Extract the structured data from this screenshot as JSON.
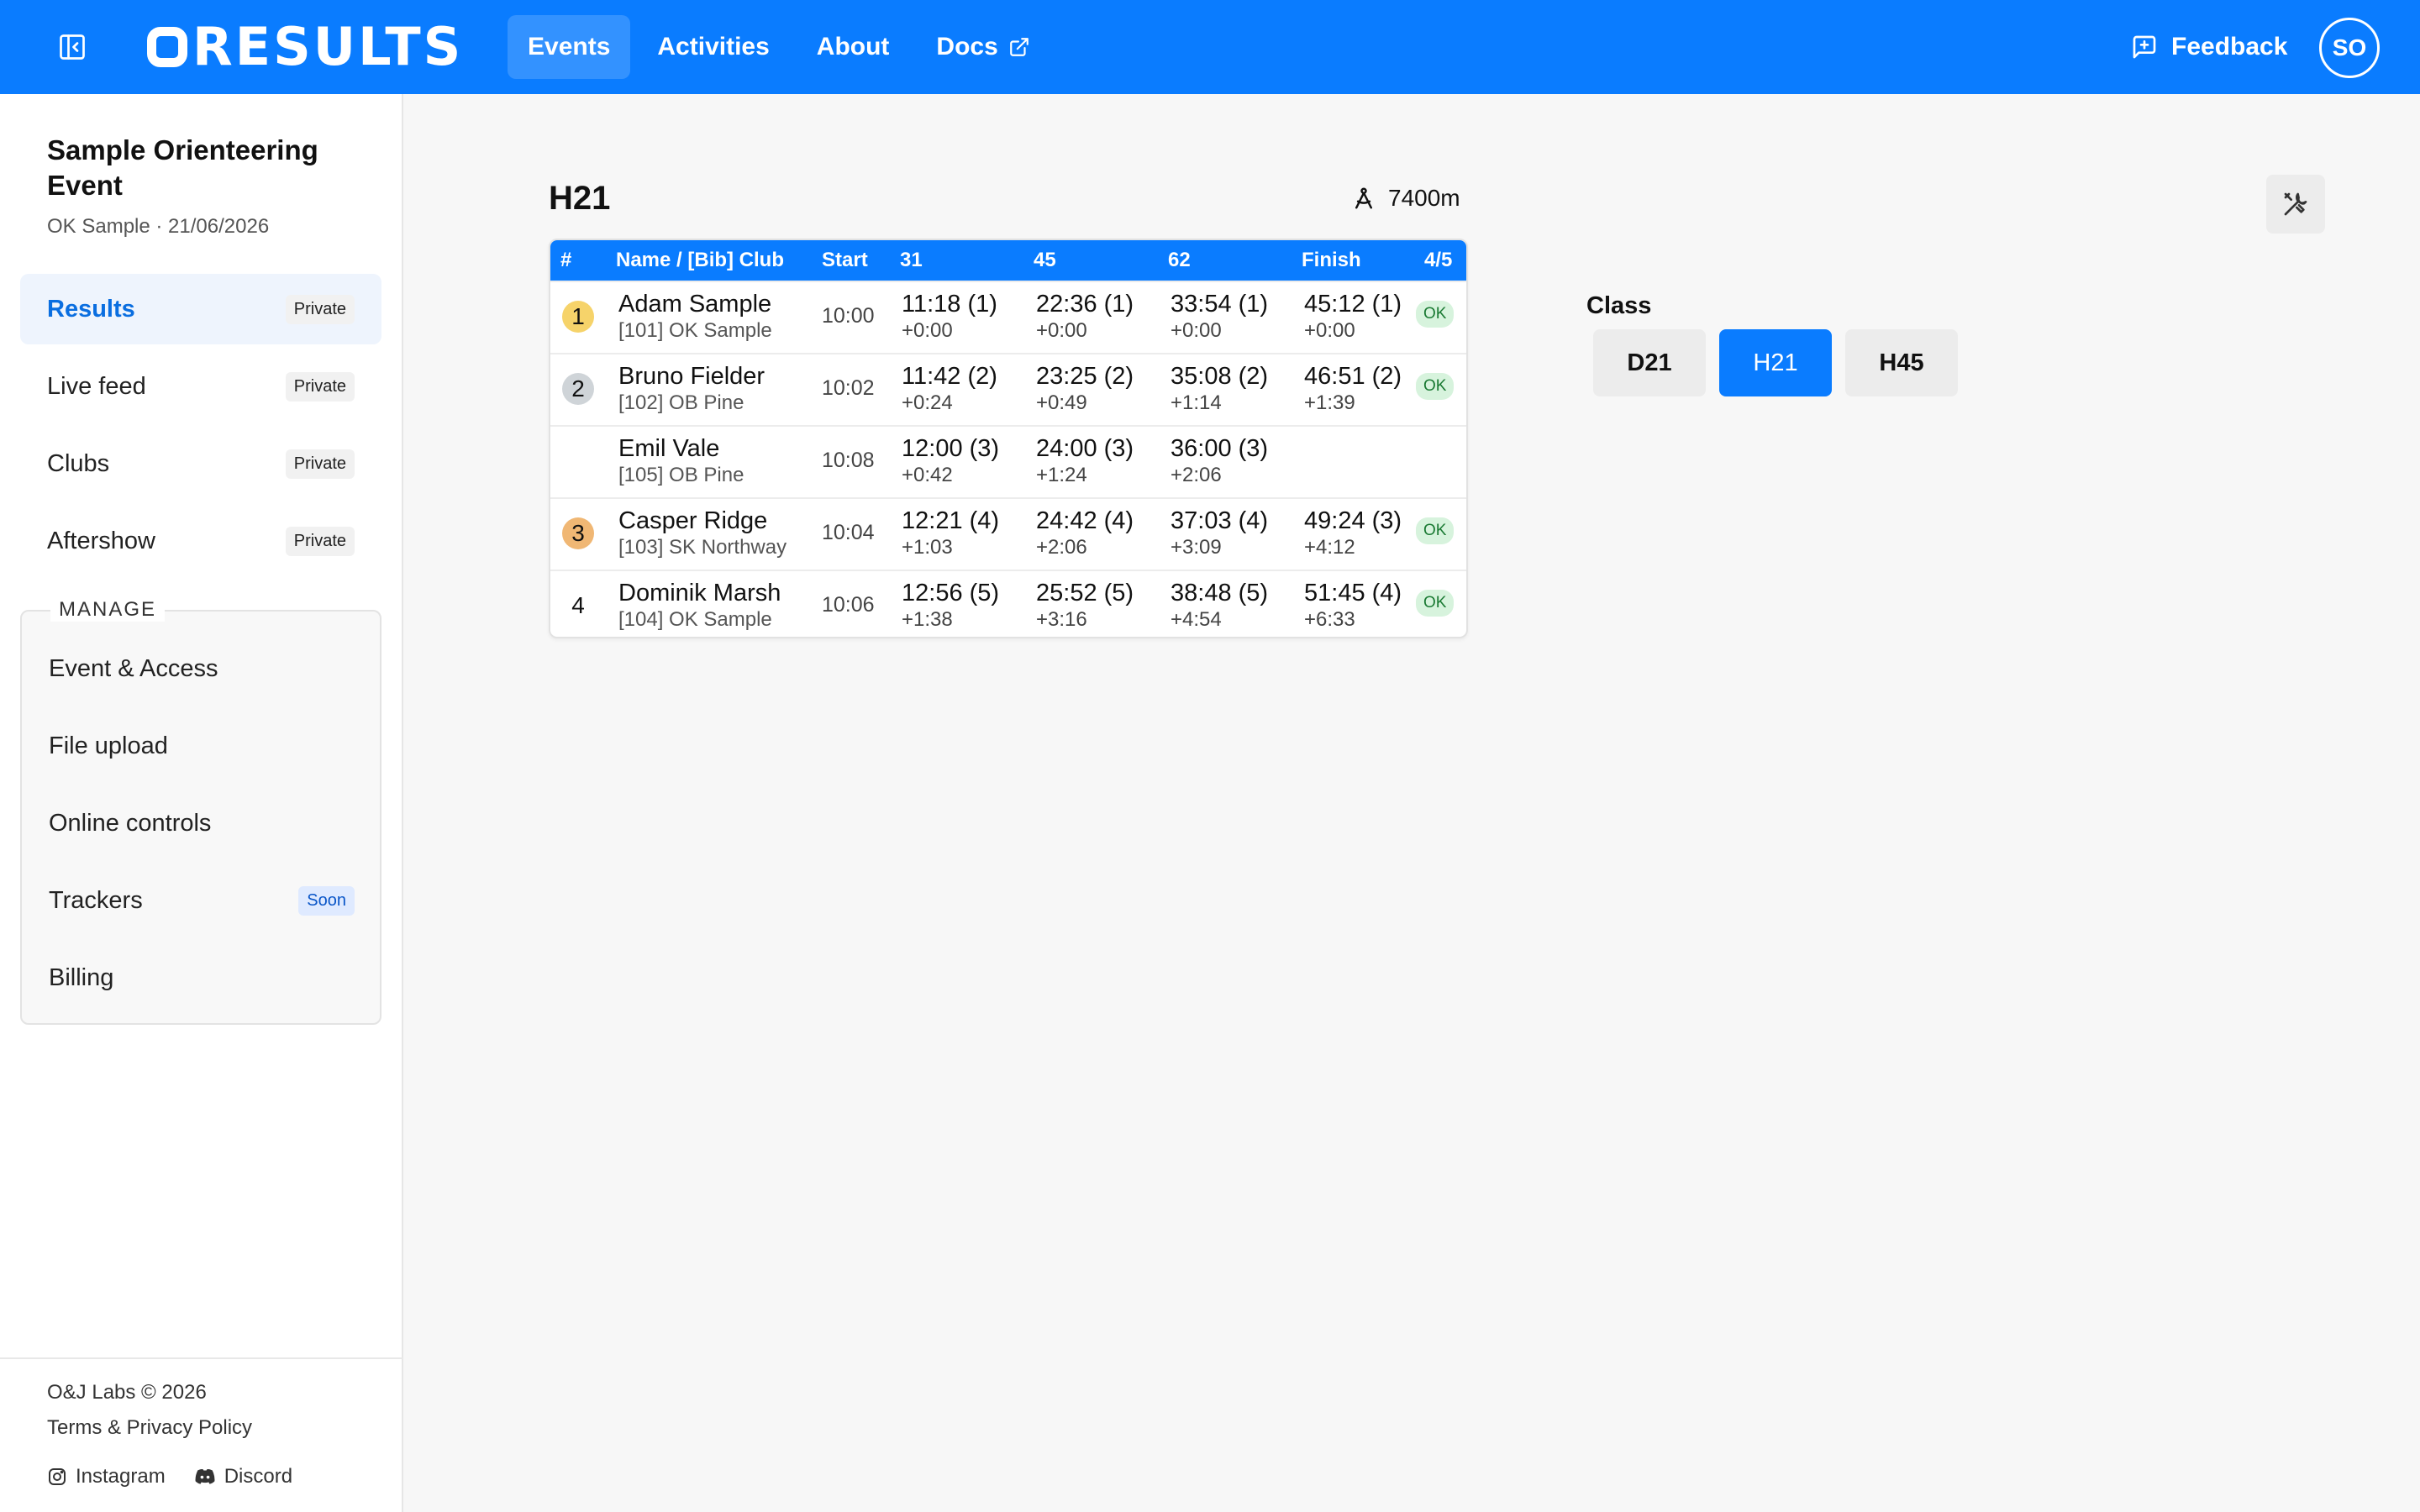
{
  "topbar": {
    "logo_text": "RESULTS",
    "nav": [
      {
        "label": "Events",
        "active": true
      },
      {
        "label": "Activities",
        "active": false
      },
      {
        "label": "About",
        "active": false
      },
      {
        "label": "Docs",
        "active": false,
        "icon": "external-link-icon"
      }
    ],
    "feedback_label": "Feedback",
    "avatar_initials": "SO",
    "accent_color": "#0a7cff"
  },
  "sidebar": {
    "event_title": "Sample Orienteering Event",
    "event_subtitle": "OK Sample · 21/06/2026",
    "items": [
      {
        "label": "Results",
        "badge": "Private",
        "active": true
      },
      {
        "label": "Live feed",
        "badge": "Private"
      },
      {
        "label": "Clubs",
        "badge": "Private"
      },
      {
        "label": "Aftershow",
        "badge": "Private"
      }
    ],
    "manage_label": "MANAGE",
    "manage_items": [
      {
        "label": "Event & Access"
      },
      {
        "label": "File upload"
      },
      {
        "label": "Online controls"
      },
      {
        "label": "Trackers",
        "badge": "Soon"
      },
      {
        "label": "Billing"
      }
    ],
    "footer": {
      "copyright": "O&J Labs © 2026",
      "terms": "Terms & Privacy Policy",
      "instagram": "Instagram",
      "discord": "Discord"
    }
  },
  "main": {
    "class_name": "H21",
    "distance": "7400m",
    "table": {
      "headers": {
        "rank": "#",
        "name": "Name / [Bib] Club",
        "start": "Start",
        "c1": "31",
        "c2": "45",
        "c3": "62",
        "finish": "Finish",
        "count": "4/5"
      },
      "rows": [
        {
          "rank": "1",
          "medal": "gold",
          "name": "Adam Sample",
          "club": "[101] OK Sample",
          "start": "10:00",
          "s1": "11:18 (1)",
          "d1": "+0:00",
          "s2": "22:36 (1)",
          "d2": "+0:00",
          "s3": "33:54 (1)",
          "d3": "+0:00",
          "finish": "45:12 (1)",
          "fdiff": "+0:00",
          "status": "OK"
        },
        {
          "rank": "2",
          "medal": "silver",
          "name": "Bruno Fielder",
          "club": "[102] OB Pine",
          "start": "10:02",
          "s1": "11:42 (2)",
          "d1": "+0:24",
          "s2": "23:25 (2)",
          "d2": "+0:49",
          "s3": "35:08 (2)",
          "d3": "+1:14",
          "finish": "46:51 (2)",
          "fdiff": "+1:39",
          "status": "OK"
        },
        {
          "rank": "",
          "medal": "",
          "name": "Emil Vale",
          "club": "[105] OB Pine",
          "start": "10:08",
          "s1": "12:00 (3)",
          "d1": "+0:42",
          "s2": "24:00 (3)",
          "d2": "+1:24",
          "s3": "36:00 (3)",
          "d3": "+2:06",
          "finish": "",
          "fdiff": "",
          "status": ""
        },
        {
          "rank": "3",
          "medal": "bronze",
          "name": "Casper Ridge",
          "club": "[103] SK Northway",
          "start": "10:04",
          "s1": "12:21 (4)",
          "d1": "+1:03",
          "s2": "24:42 (4)",
          "d2": "+2:06",
          "s3": "37:03 (4)",
          "d3": "+3:09",
          "finish": "49:24 (3)",
          "fdiff": "+4:12",
          "status": "OK"
        },
        {
          "rank": "4",
          "medal": "",
          "name": "Dominik Marsh",
          "club": "[104] OK Sample",
          "start": "10:06",
          "s1": "12:56 (5)",
          "d1": "+1:38",
          "s2": "25:52 (5)",
          "d2": "+3:16",
          "s3": "38:48 (5)",
          "d3": "+4:54",
          "finish": "51:45 (4)",
          "fdiff": "+6:33",
          "status": "OK"
        }
      ]
    },
    "class_picker": {
      "label": "Class",
      "options": [
        {
          "label": "D21",
          "active": false
        },
        {
          "label": "H21",
          "active": true
        },
        {
          "label": "H45",
          "active": false
        }
      ]
    }
  }
}
